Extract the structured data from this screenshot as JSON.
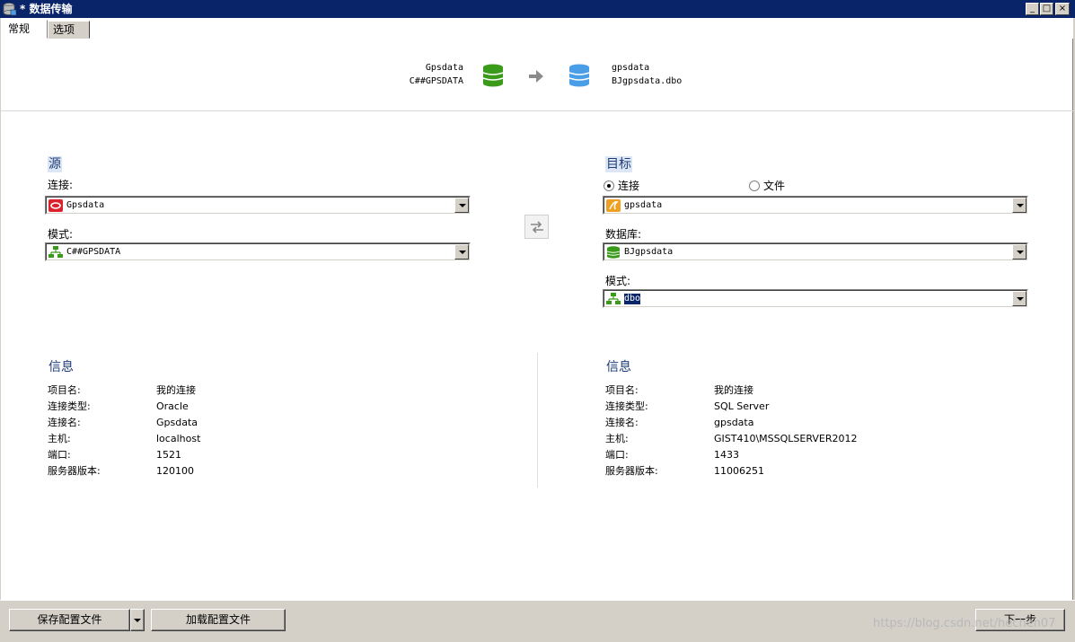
{
  "window": {
    "title": "* 数据传输"
  },
  "tabs": [
    {
      "label": "常规"
    },
    {
      "label": "选项"
    }
  ],
  "header": {
    "source_name": "Gpsdata",
    "source_schema": "C##GPSDATA",
    "target_name": "gpsdata",
    "target_schema": "BJgpsdata.dbo"
  },
  "source": {
    "section_title": "源",
    "connection_label": "连接:",
    "connection_value": "Gpsdata",
    "schema_label": "模式:",
    "schema_value": "C##GPSDATA"
  },
  "target": {
    "section_title": "目标",
    "radio_connection": "连接",
    "radio_file": "文件",
    "connection_value": "gpsdata",
    "database_label": "数据库:",
    "database_value": "BJgpsdata",
    "schema_label": "模式:",
    "schema_value": "dbo"
  },
  "source_info": {
    "title": "信息",
    "rows": [
      {
        "key": "项目名:",
        "value": "我的连接"
      },
      {
        "key": "连接类型:",
        "value": "Oracle"
      },
      {
        "key": "连接名:",
        "value": "Gpsdata"
      },
      {
        "key": "主机:",
        "value": "localhost"
      },
      {
        "key": "端口:",
        "value": "1521"
      },
      {
        "key": "服务器版本:",
        "value": "120100"
      }
    ]
  },
  "target_info": {
    "title": "信息",
    "rows": [
      {
        "key": "项目名:",
        "value": "我的连接"
      },
      {
        "key": "连接类型:",
        "value": "SQL Server"
      },
      {
        "key": "连接名:",
        "value": "gpsdata"
      },
      {
        "key": "主机:",
        "value": "GIST410\\MSSQLSERVER2012"
      },
      {
        "key": "端口:",
        "value": "1433"
      },
      {
        "key": "服务器版本:",
        "value": "11006251"
      }
    ]
  },
  "footer": {
    "save_profile": "保存配置文件",
    "load_profile": "加载配置文件",
    "next": "下一步",
    "watermark": "https://blog.csdn.net/hechen07"
  },
  "colors": {
    "title_bar": "#0a246a",
    "oracle_db": "#3a9a1a",
    "sqlserver_db": "#4a9ee8",
    "section_title": "#1e3c78"
  }
}
